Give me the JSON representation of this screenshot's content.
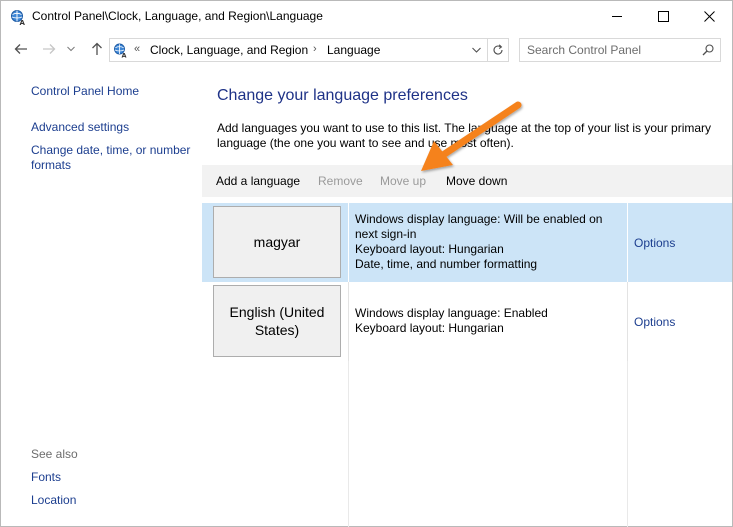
{
  "window": {
    "title": "Control Panel\\Clock, Language, and Region\\Language"
  },
  "address_bar": {
    "overflow": "«",
    "crumbs": [
      "Clock, Language, and Region",
      "Language"
    ],
    "separator": "›"
  },
  "search": {
    "placeholder": "Search Control Panel"
  },
  "sidebar": {
    "home": "Control Panel Home",
    "advanced": "Advanced settings",
    "date_line1": "Change date, time, or number",
    "date_line2": "formats",
    "see_also": "See also",
    "fonts": "Fonts",
    "location": "Location"
  },
  "main": {
    "heading": "Change your language preferences",
    "description": "Add languages you want to use to this list. The language at the top of your list is your primary language (the one you want to see and use most often)."
  },
  "toolbar": {
    "add": "Add a language",
    "remove": "Remove",
    "move_up": "Move up",
    "move_down": "Move down"
  },
  "languages": [
    {
      "name": "magyar",
      "details": [
        "Windows display language: Will be enabled on",
        "next sign-in",
        "Keyboard layout: Hungarian",
        "Date, time, and number formatting"
      ],
      "options": "Options",
      "selected": true
    },
    {
      "name": "English (United States)",
      "details": [
        "Windows display language: Enabled",
        "Keyboard layout: Hungarian"
      ],
      "options": "Options",
      "selected": false
    }
  ],
  "colors": {
    "link": "#1c3e8f",
    "heading": "#1e3287",
    "selected_row": "#cce4f7",
    "toolbar_bg": "#f2f2f2",
    "disabled_text": "#9a9a9a",
    "annotation_arrow": "#f5821f"
  },
  "icons": {
    "app": "control-panel-icon",
    "back": "arrow-left-icon",
    "forward": "arrow-right-icon",
    "recent": "chevron-down-icon",
    "up": "arrow-up-icon",
    "address_dropdown": "chevron-down-icon",
    "refresh": "refresh-icon",
    "search": "search-icon",
    "minimize": "minimize-icon",
    "maximize": "maximize-icon",
    "close": "close-icon"
  }
}
